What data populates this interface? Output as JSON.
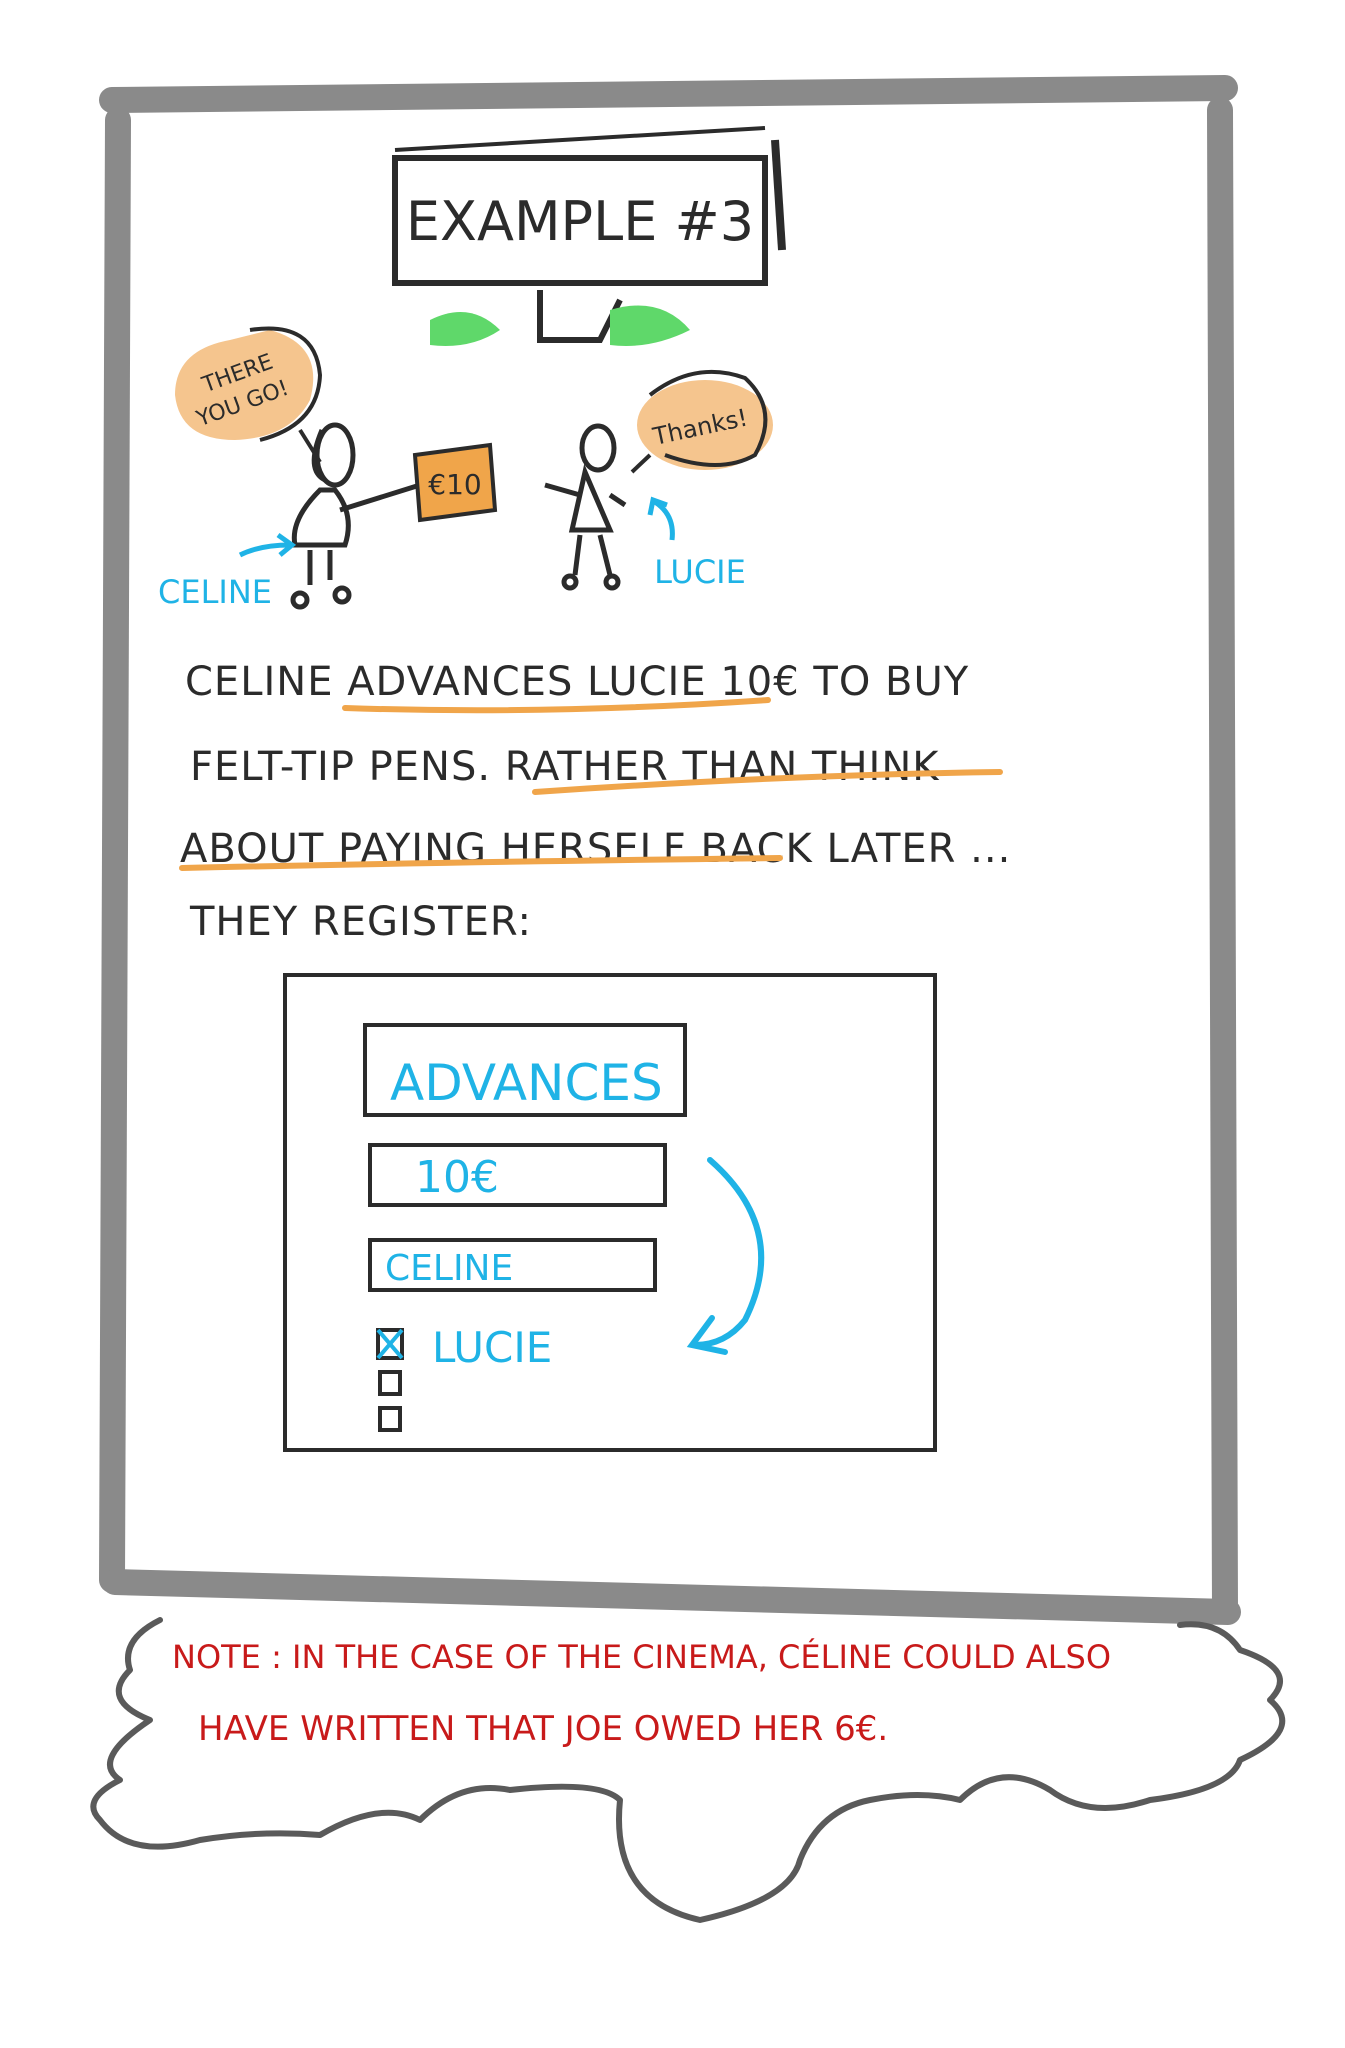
{
  "colors": {
    "frame": "#8a8a8a",
    "ink": "#2b2b2b",
    "blue": "#1fb3e6",
    "orange": "#f0a54a",
    "green": "#5fd86a",
    "red": "#c81a1a",
    "bubble_fill": "#f5c58e"
  },
  "header": {
    "title": "EXAMPLE #3"
  },
  "illustration": {
    "speech_celine": [
      "THERE",
      "YOU GO!"
    ],
    "speech_lucie": "Thanks!",
    "banknote": "€10",
    "label_celine": "CELINE",
    "label_lucie": "LUCIE"
  },
  "narrative": {
    "line1": "CELINE ADVANCES LUCIE 10€ TO BUY",
    "line2": "FELT-TIP PENS. RATHER THAN THINK",
    "line3": "ABOUT PAYING HERSELF BACK LATER ...",
    "line4": "THEY REGISTER:"
  },
  "form": {
    "type_value": "ADVANCES",
    "amount_value": "10€",
    "payer_value": "CELINE",
    "beneficiaries": [
      {
        "label": "LUCIE",
        "checked": true
      },
      {
        "label": "",
        "checked": false
      },
      {
        "label": "",
        "checked": false
      }
    ]
  },
  "note": {
    "line1": "NOTE : IN THE CASE OF THE CINEMA, CÉLINE COULD ALSO",
    "line2": "HAVE WRITTEN THAT JOE OWED HER 6€."
  }
}
